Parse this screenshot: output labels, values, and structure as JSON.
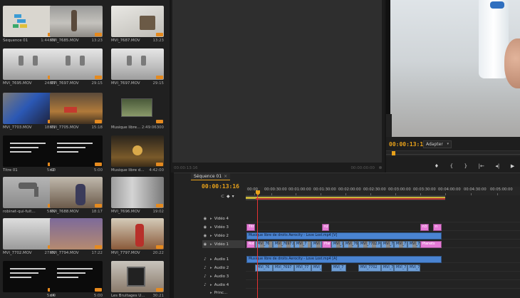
{
  "bin": {
    "clips": [
      {
        "name": "Séquence 01",
        "dur": "1:44:08",
        "art": "t-seq"
      },
      {
        "name": "MVI_7685.MOV",
        "dur": "13:23",
        "art": "t-room"
      },
      {
        "name": "MVI_7687.MOV",
        "dur": "13:23",
        "art": "t-white"
      },
      {
        "name": "MVI_7695.MOV",
        "dur": "24:17",
        "art": "t-sink"
      },
      {
        "name": "MVI_7697.MOV",
        "dur": "29:15",
        "art": "t-sink"
      },
      {
        "name": "MVI_7697.MOV",
        "dur": "29:15",
        "art": "t-sink"
      },
      {
        "name": "MVI_7703.MOV",
        "dur": "18:01",
        "art": "t-tv"
      },
      {
        "name": "MVI_7705.MOV",
        "dur": "15:18",
        "art": "t-toys"
      },
      {
        "name": "Musique libre de...",
        "dur": "2:49:06300",
        "art": "t-music"
      },
      {
        "name": "Titre 01",
        "dur": "5:00",
        "art": "t-black"
      },
      {
        "name": "n2",
        "dur": "5:00",
        "art": "t-black"
      },
      {
        "name": "Musique libre de dr...",
        "dur": "4:42:00",
        "art": "t-dark"
      },
      {
        "name": "robinet-qui-fuit_34660...",
        "dur": "5:00",
        "art": "t-tap"
      },
      {
        "name": "MVI_7688.MOV",
        "dur": "18:17",
        "art": "t-kid"
      },
      {
        "name": "MVI_7696.MOV",
        "dur": "19:02",
        "art": "t-door"
      },
      {
        "name": "MVI_7702.MOV",
        "dur": "27:00",
        "art": "t-sink2"
      },
      {
        "name": "MVI_7794.MOV",
        "dur": "17:22",
        "art": "t-hands"
      },
      {
        "name": "MVI_7797.MOV",
        "dur": "20:22",
        "art": "t-kid2"
      },
      {
        "name": "",
        "dur": "5:00",
        "art": "t-black"
      },
      {
        "name": "n4",
        "dur": "5:00",
        "art": "t-black"
      },
      {
        "name": "Les Bruitages Util...",
        "dur": "30:21",
        "art": "t-tablet"
      }
    ]
  },
  "source_monitor": {
    "timecode": "00:00:13:16",
    "timecode_right": "00:00:00:00"
  },
  "program_monitor": {
    "timecode": "00:00:13:16",
    "fit": "Adapter",
    "controls": [
      "♦",
      "{",
      "}",
      "|←",
      "◂|",
      "▶"
    ]
  },
  "timeline": {
    "tab": "Séquence 01",
    "timecode": "00:00:13:16",
    "ruler": [
      "00:00",
      "00:00:30:00",
      "00:01:00:00",
      "00:01:30:00",
      "00:02:00:00",
      "00:02:30:00",
      "00:03:00:00",
      "00:03:30:00",
      "00:04:00:00",
      "00:04:30:00",
      "00:05:00:00"
    ],
    "tracks": {
      "v4": "Vidéo 4",
      "v3": "Vidéo 3",
      "v2": "Vidéo 2",
      "v1": "Vidéo 1",
      "a1": "Audio 1",
      "a2": "Audio 2",
      "a3": "Audio 3",
      "a4": "Audio 4",
      "master": "Princ..."
    },
    "clips": {
      "v3_1": "Titr",
      "v3_2": "n2",
      "v3_3": "n3",
      "v3_4": "n",
      "v2_seq": "Musique libre de droits Aerocity - Love Lost.mp4 [V]",
      "v1_items": [
        "Rob",
        "MVI_76",
        "MVI_7697.M",
        "MVI_7",
        "MVI",
        "Plan",
        "MVI_7",
        "MVI_76",
        "MVI_7702.M",
        "MVI_7",
        "MVI_7",
        "MVI_7",
        "Planets"
      ],
      "a1_seq": "Musique libre de droits Aerocity - Love Lost.mp4 [A]",
      "a2_items": [
        "MVI_76",
        "MVI_7697",
        "MVI_77",
        "MVI_",
        "MVI_7",
        "MVI_7702",
        "MVI_7",
        "MVI_7",
        "MVI_7"
      ]
    }
  }
}
